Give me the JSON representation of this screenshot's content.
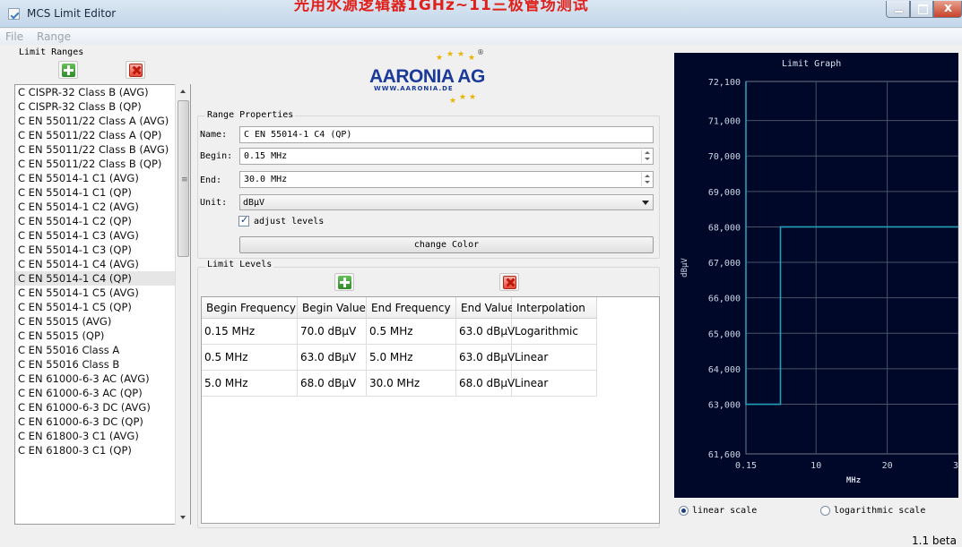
{
  "window": {
    "title": "MCS Limit Editor",
    "overlay_text": "光用水源逻辑器1GHz~11三极管场测试"
  },
  "menu": [
    "File",
    "Range"
  ],
  "limit_ranges": {
    "title": "Limit Ranges",
    "items": [
      "C CISPR-32 Class B (AVG)",
      "C CISPR-32 Class B (QP)",
      "C EN 55011/22 Class A (AVG)",
      "C EN 55011/22 Class A (QP)",
      "C EN 55011/22 Class B (AVG)",
      "C EN 55011/22 Class B (QP)",
      "C EN 55014-1 C1 (AVG)",
      "C EN 55014-1 C1 (QP)",
      "C EN 55014-1 C2 (AVG)",
      "C EN 55014-1 C2 (QP)",
      "C EN 55014-1 C3 (AVG)",
      "C EN 55014-1 C3 (QP)",
      "C EN 55014-1 C4 (AVG)",
      "C EN 55014-1 C4 (QP)",
      "C EN 55014-1 C5 (AVG)",
      "C EN 55014-1 C5 (QP)",
      "C EN 55015 (AVG)",
      "C EN 55015 (QP)",
      "C EN 55016 Class A",
      "C EN 55016 Class B",
      "C EN 61000-6-3 AC (AVG)",
      "C EN 61000-6-3 AC (QP)",
      "C EN 61000-6-3 DC (AVG)",
      "C EN 61000-6-3 DC (QP)",
      "C EN 61800-3 C1 (AVG)",
      "C EN 61800-3 C1 (QP)"
    ],
    "selected_index": 13,
    "scroll_grip": "≡"
  },
  "logo": {
    "name": "AARONIA AG",
    "url": "WWW.AARONIA.DE",
    "registered": "®"
  },
  "range_properties": {
    "title": "Range Properties",
    "name_label": "Name:",
    "name_value": "C EN 55014-1 C4 (QP)",
    "begin_label": "Begin:",
    "begin_value": "0.15 MHz",
    "end_label": "End:",
    "end_value": "30.0 MHz",
    "unit_label": "Unit:",
    "unit_value": "dBµV",
    "adjust_label": "adjust levels",
    "adjust_checked": true,
    "change_color_label": "change Color"
  },
  "limit_levels": {
    "title": "Limit Levels",
    "columns": [
      "Begin Frequency",
      "Begin Value",
      "End Frequency",
      "End Value",
      "Interpolation"
    ],
    "rows": [
      [
        "0.15 MHz",
        "70.0 dBµV",
        "0.5 MHz",
        "63.0 dBµV",
        "Logarithmic"
      ],
      [
        "0.5 MHz",
        "63.0 dBµV",
        "5.0 MHz",
        "63.0 dBµV",
        "Linear"
      ],
      [
        "5.0 MHz",
        "68.0 dBµV",
        "30.0 MHz",
        "68.0 dBµV",
        "Linear"
      ]
    ]
  },
  "graph": {
    "title": "Limit Graph",
    "scale_linear_label": "linear scale",
    "scale_log_label": "logarithmic scale",
    "selected_scale": "linear"
  },
  "chart_data": {
    "type": "line",
    "title": "Limit Graph",
    "xlabel": "MHz",
    "ylabel": "dBµV",
    "x_ticks": [
      "0.15",
      "10",
      "20",
      "30"
    ],
    "y_ticks": [
      "72,100",
      "71,000",
      "70,000",
      "69,000",
      "68,000",
      "67,000",
      "66,000",
      "65,000",
      "64,000",
      "63,000",
      "61,600"
    ],
    "xlim": [
      0.15,
      30
    ],
    "ylim": [
      61.6,
      72.1
    ],
    "grid": true,
    "line_color": "#22a0b8",
    "series": [
      {
        "x": [
          0.15,
          0.15,
          0.5,
          5.0,
          5.0,
          30.0
        ],
        "y": [
          72.1,
          63.0,
          63.0,
          63.0,
          68.0,
          68.0
        ]
      }
    ]
  },
  "footer": {
    "version": "1.1 beta"
  },
  "colors": {
    "graph_bg": "#000829",
    "grid": "#4a5266",
    "accent": "#1b3a9a"
  }
}
